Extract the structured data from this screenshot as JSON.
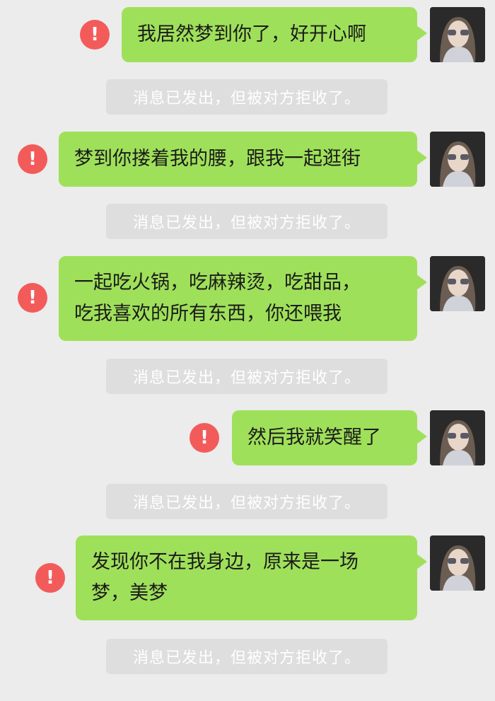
{
  "messages": [
    {
      "text": "我居然梦到你了，好开心啊",
      "status_icon": "exclamation-icon"
    },
    {
      "text": "梦到你搂着我的腰，跟我一起逛街",
      "status_icon": "exclamation-icon"
    },
    {
      "text": "一起吃火锅，吃麻辣烫，吃甜品，\n吃我喜欢的所有东西，你还喂我",
      "status_icon": "exclamation-icon"
    },
    {
      "text": "然后我就笑醒了",
      "status_icon": "exclamation-icon"
    },
    {
      "text": "发现你不在我身边，原来是一场\n梦，美梦",
      "status_icon": "exclamation-icon"
    }
  ],
  "system_notices": [
    "消息已发出，但被对方拒收了。",
    "消息已发出，但被对方拒收了。",
    "消息已发出，但被对方拒收了。",
    "消息已发出，但被对方拒收了。",
    "消息已发出，但被对方拒收了。"
  ],
  "error_glyph": "!",
  "colors": {
    "bubble": "#9fe05a",
    "error": "#f35b5b",
    "notice_bg": "#dedede",
    "background": "#ececec"
  }
}
